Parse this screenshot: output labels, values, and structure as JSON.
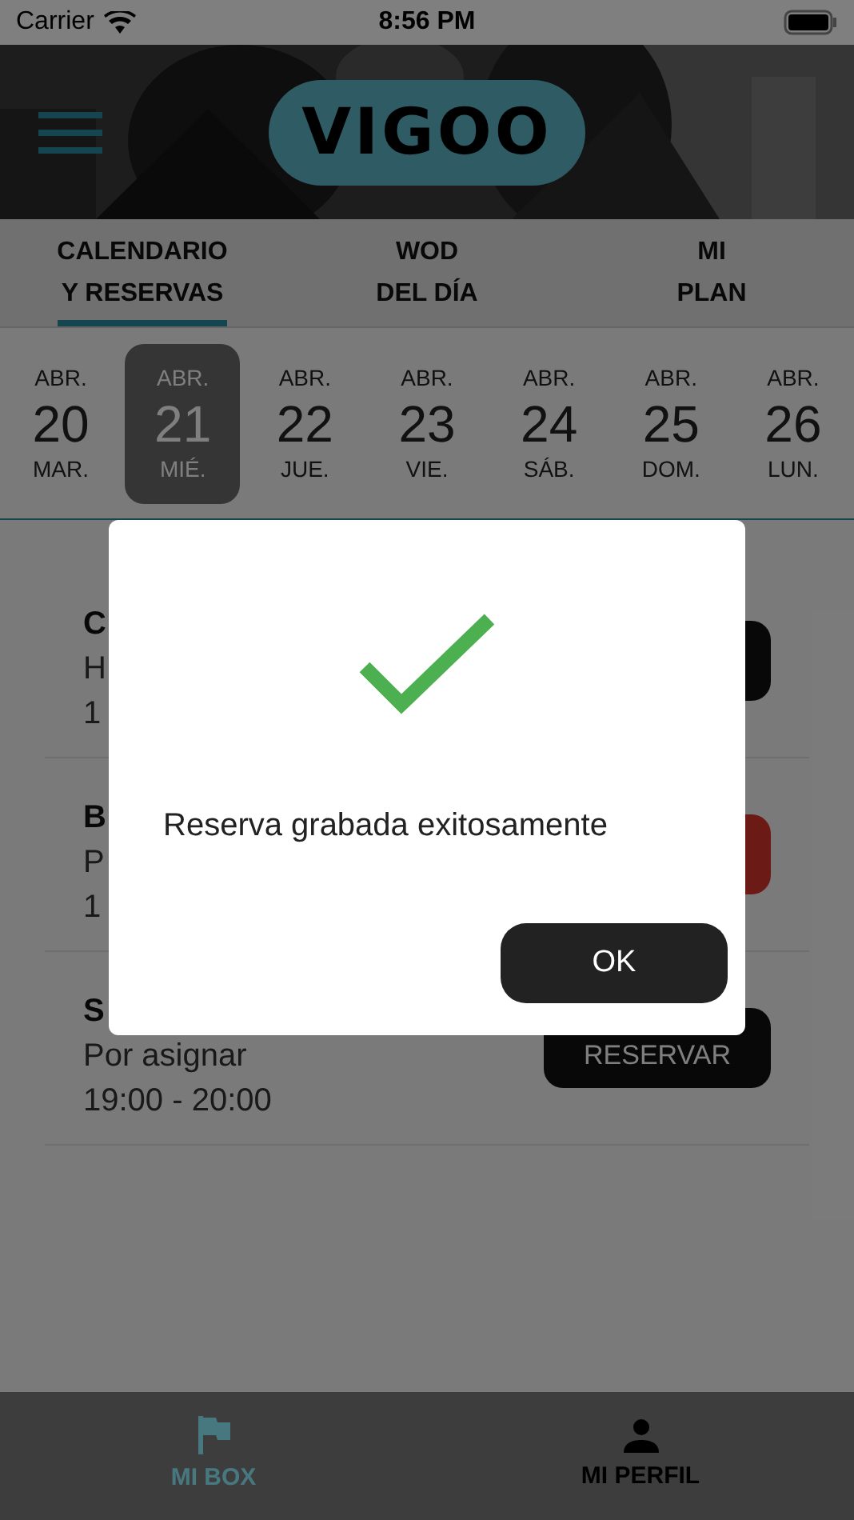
{
  "status_bar": {
    "carrier": "Carrier",
    "time": "8:56 PM"
  },
  "header": {
    "logo": "VIGOO"
  },
  "tabs": [
    {
      "lines": [
        "CALENDARIO",
        "Y RESERVAS"
      ],
      "selected": true
    },
    {
      "lines": [
        "WOD",
        "DEL DÍA"
      ],
      "selected": false
    },
    {
      "lines": [
        "MI",
        "PLAN"
      ],
      "selected": false
    }
  ],
  "dates": [
    {
      "month": "ABR.",
      "day": "20",
      "weekday": "MAR.",
      "selected": false
    },
    {
      "month": "ABR.",
      "day": "21",
      "weekday": "MIÉ.",
      "selected": true
    },
    {
      "month": "ABR.",
      "day": "22",
      "weekday": "JUE.",
      "selected": false
    },
    {
      "month": "ABR.",
      "day": "23",
      "weekday": "VIE.",
      "selected": false
    },
    {
      "month": "ABR.",
      "day": "24",
      "weekday": "SÁB.",
      "selected": false
    },
    {
      "month": "ABR.",
      "day": "25",
      "weekday": "DOM.",
      "selected": false
    },
    {
      "month": "ABR.",
      "day": "26",
      "weekday": "LUN.",
      "selected": false
    }
  ],
  "classes": [
    {
      "title": "C",
      "coach": "H",
      "time": "1",
      "button": {
        "kind": "dark"
      }
    },
    {
      "title": "B",
      "coach": "P",
      "time": "1",
      "button": {
        "kind": "cancel"
      }
    },
    {
      "title": "S",
      "coach": "Por asignar",
      "time": "19:00 - 20:00",
      "button": {
        "kind": "dark",
        "label": "RESERVAR"
      }
    }
  ],
  "dialog": {
    "message": "Reserva grabada exitosamente",
    "button": "OK"
  },
  "bottom_nav": [
    {
      "label": "MI BOX",
      "selected": true
    },
    {
      "label": "MI PERFIL",
      "selected": false
    }
  ]
}
